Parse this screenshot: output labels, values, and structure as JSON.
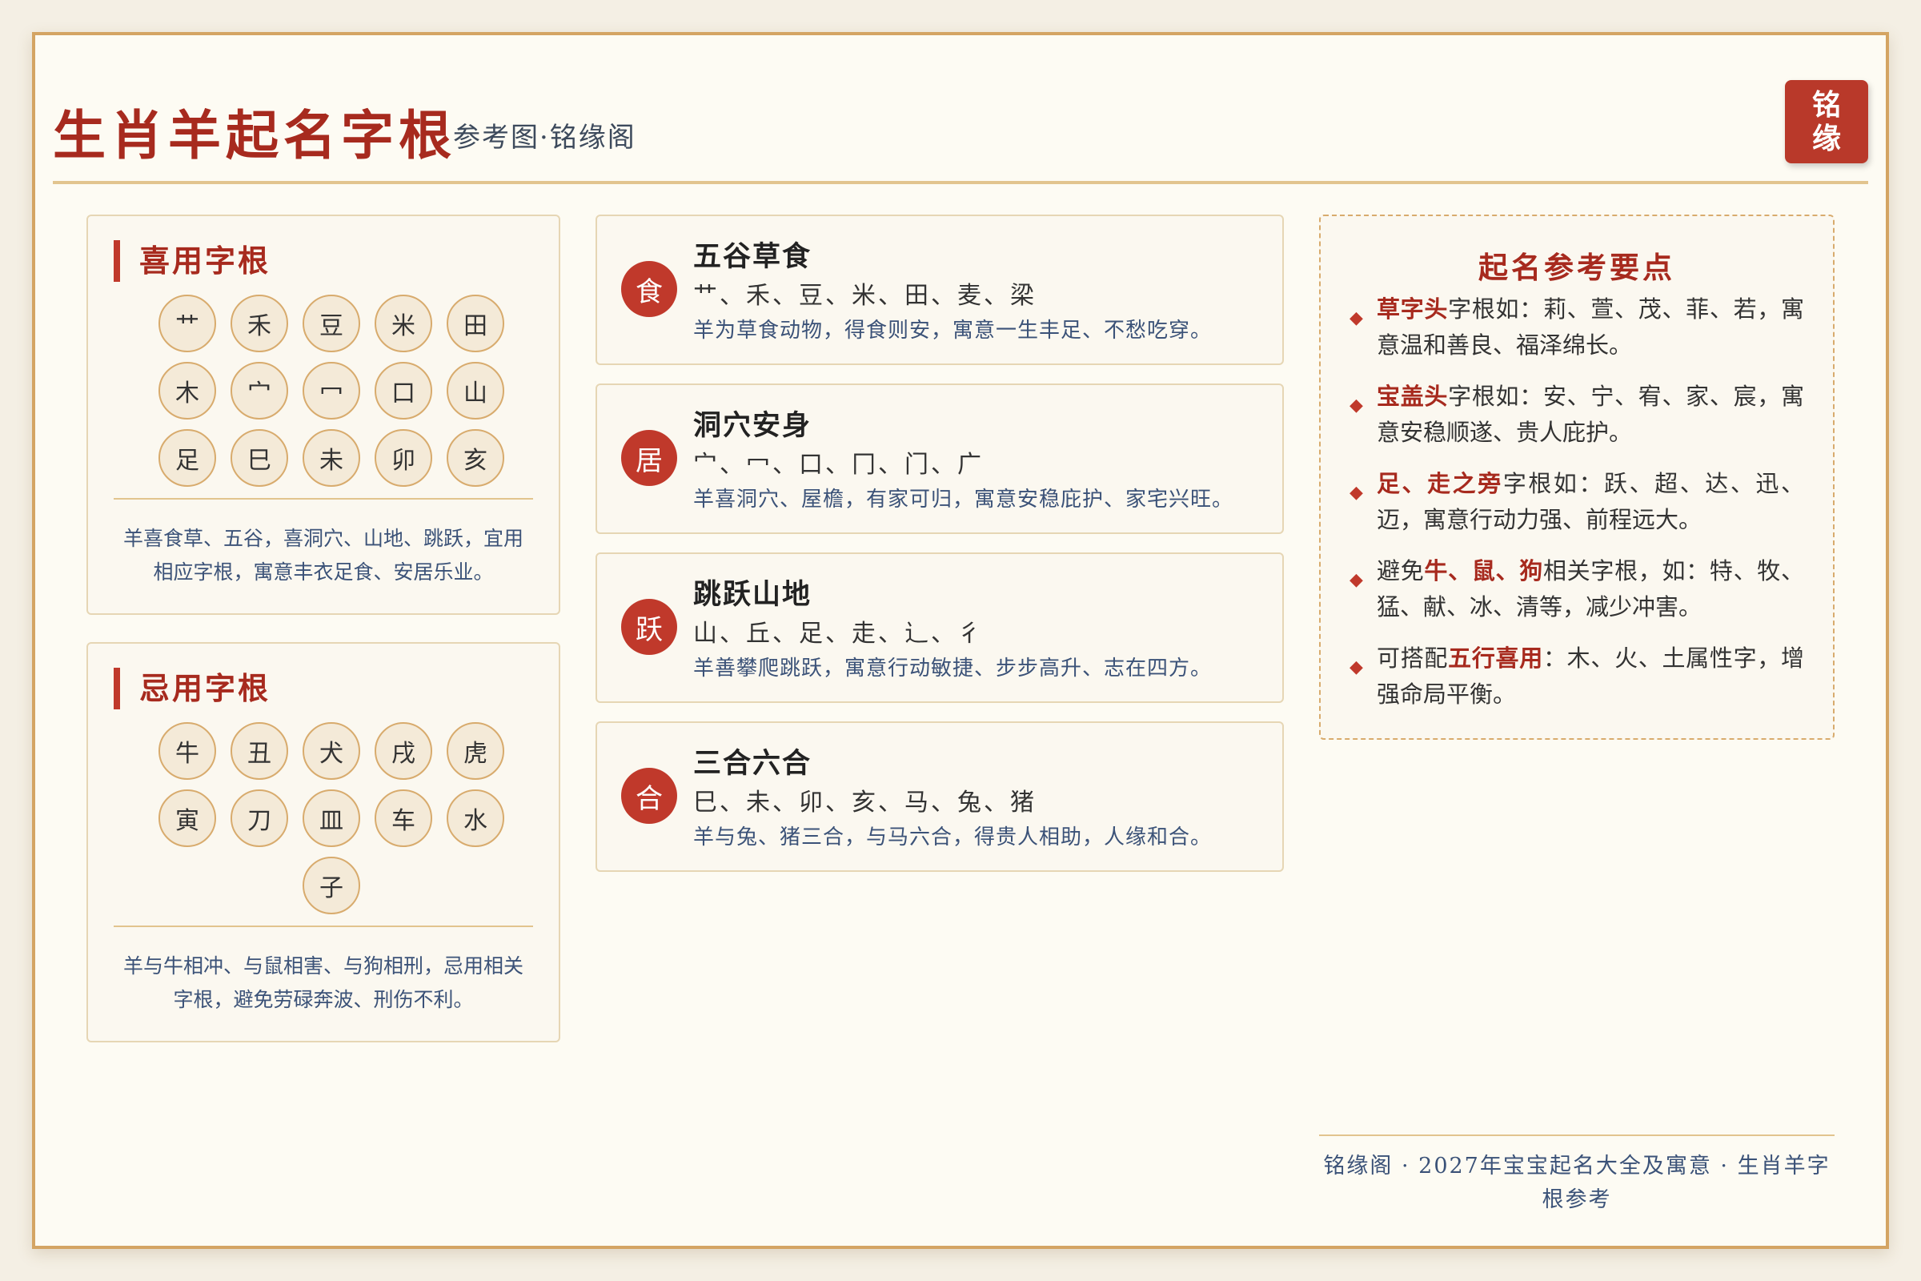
{
  "header": {
    "title": "生肖羊起名字根",
    "subtitle": "参考图·铭缘阁",
    "seal_line1": "铭",
    "seal_line2": "缘"
  },
  "favorable": {
    "title": "喜用字根",
    "roots": [
      "艹",
      "禾",
      "豆",
      "米",
      "田",
      "木",
      "宀",
      "冖",
      "口",
      "山",
      "足",
      "巳",
      "未",
      "卯",
      "亥"
    ],
    "note": "羊喜食草、五谷，喜洞穴、山地、跳跃，宜用相应字根，寓意丰衣足食、安居乐业。"
  },
  "unfavorable": {
    "title": "忌用字根",
    "roots": [
      "牛",
      "丑",
      "犬",
      "戌",
      "虎",
      "寅",
      "刀",
      "皿",
      "车",
      "水",
      "子"
    ],
    "note": "羊与牛相冲、与鼠相害、与狗相刑，忌用相关字根，避免劳碌奔波、刑伤不利。"
  },
  "cards": [
    {
      "badge": "食",
      "title": "五谷草食",
      "roots": "艹、禾、豆、米、田、麦、梁",
      "note": "羊为草食动物，得食则安，寓意一生丰足、不愁吃穿。"
    },
    {
      "badge": "居",
      "title": "洞穴安身",
      "roots": "宀、冖、口、冂、门、广",
      "note": "羊喜洞穴、屋檐，有家可归，寓意安稳庇护、家宅兴旺。"
    },
    {
      "badge": "跃",
      "title": "跳跃山地",
      "roots": "山、丘、足、走、辶、彳",
      "note": "羊善攀爬跳跃，寓意行动敏捷、步步高升、志在四方。"
    },
    {
      "badge": "合",
      "title": "三合六合",
      "roots": "巳、未、卯、亥、马、兔、猪",
      "note": "羊与兔、猪三合，与马六合，得贵人相助，人缘和合。"
    }
  ],
  "tips": {
    "title": "起名参考要点",
    "items": [
      {
        "pre": "",
        "em": "草字头",
        "post": "字根如：莉、萱、茂、菲、若，寓意温和善良、福泽绵长。"
      },
      {
        "pre": "",
        "em": "宝盖头",
        "post": "字根如：安、宁、宥、家、宸，寓意安稳顺遂、贵人庇护。"
      },
      {
        "pre": "",
        "em": "足、走之旁",
        "post": "字根如：跃、超、达、迅、迈，寓意行动力强、前程远大。"
      },
      {
        "pre": "避免",
        "em": "牛、鼠、狗",
        "post": "相关字根，如：特、牧、猛、献、冰、清等，减少冲害。"
      },
      {
        "pre": "可搭配",
        "em": "五行喜用",
        "post": "：木、火、土属性字，增强命局平衡。"
      }
    ]
  },
  "footer": "铭缘阁 · 2027年宝宝起名大全及寓意 · 生肖羊字根参考"
}
